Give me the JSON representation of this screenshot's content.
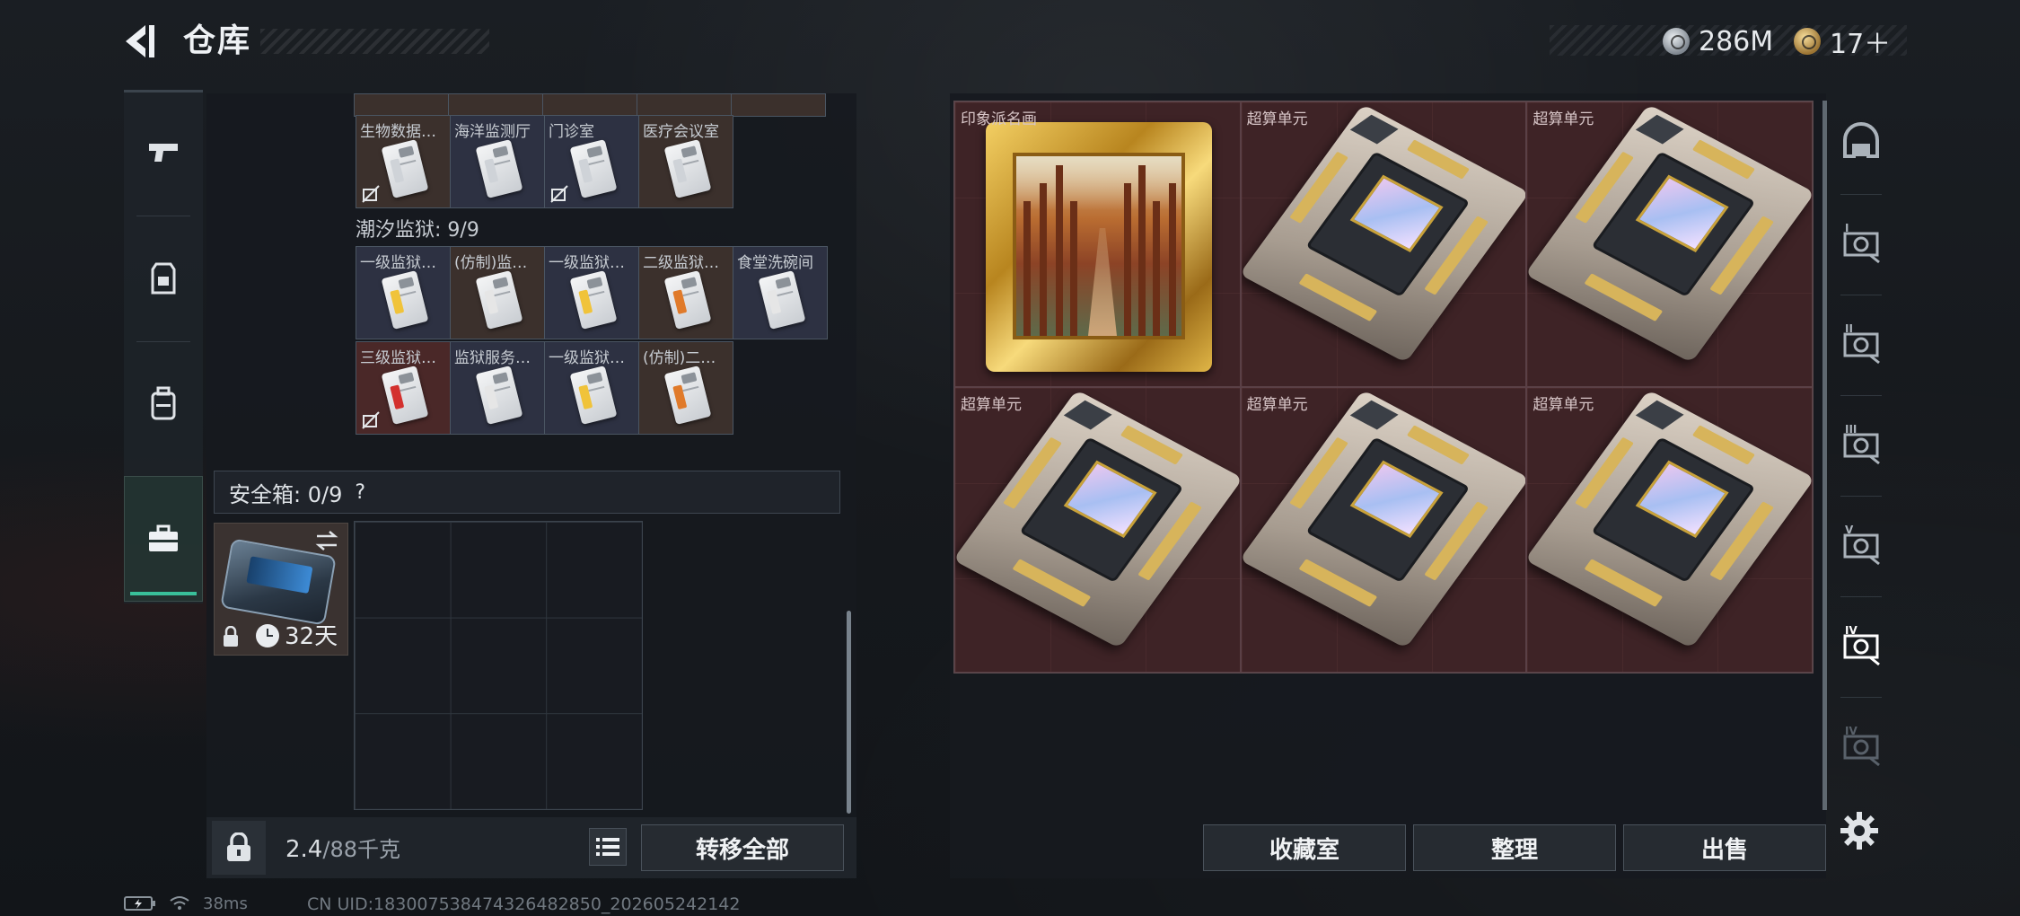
{
  "header": {
    "title": "仓库"
  },
  "currency": [
    {
      "icon": "silver-coin-icon",
      "value": "286M"
    },
    {
      "icon": "gold-coin-icon",
      "value": "17＋"
    }
  ],
  "left_categories": [
    {
      "name": "weapons",
      "icon": "pistol-icon"
    },
    {
      "name": "armor",
      "icon": "vest-icon"
    },
    {
      "name": "backpack",
      "icon": "backpack-icon"
    },
    {
      "name": "cases",
      "icon": "toolbox-icon",
      "active": true
    }
  ],
  "stash": {
    "row_top": [
      {
        "label": "生物数据…",
        "color": "brown",
        "no_link": true
      },
      {
        "label": "海洋监测厅",
        "color": "slate",
        "no_link": false
      },
      {
        "label": "门诊室",
        "color": "slate",
        "no_link": true
      },
      {
        "label": "医疗会议室",
        "color": "brown",
        "no_link": false
      }
    ],
    "section_title": "潮汐监狱: 9/9",
    "row_a": [
      {
        "label": "一级监狱…",
        "color": "slate",
        "stripe": "#f0c33a"
      },
      {
        "label": "(仿制)监…",
        "color": "brown",
        "stripe": "#e6e6e6"
      },
      {
        "label": "一级监狱…",
        "color": "slate",
        "stripe": "#f0c33a"
      },
      {
        "label": "二级监狱…",
        "color": "brown",
        "stripe": "#e07a2a"
      },
      {
        "label": "食堂洗碗间",
        "color": "slate",
        "stripe": "#e6e6e6"
      }
    ],
    "row_b": [
      {
        "label": "三级监狱…",
        "color": "red",
        "stripe": "#d3312e",
        "no_link": true
      },
      {
        "label": "监狱服务…",
        "color": "slate",
        "stripe": "#e6e6e6"
      },
      {
        "label": "一级监狱…",
        "color": "slate",
        "stripe": "#f0c33a"
      },
      {
        "label": "(仿制)二…",
        "color": "brown",
        "stripe": "#e07a2a"
      }
    ],
    "safe_box": {
      "label": "安全箱: 0/9",
      "help": "?",
      "days": "32天"
    },
    "weight": {
      "current": "2.4",
      "max": "/88千克"
    },
    "transfer_all": "转移全部"
  },
  "container": {
    "items": [
      {
        "label": "印象派名画",
        "type": "painting"
      },
      {
        "label": "超算单元",
        "type": "board"
      },
      {
        "label": "超算单元",
        "type": "board"
      },
      {
        "label": "超算单元",
        "type": "board"
      },
      {
        "label": "超算单元",
        "type": "board"
      },
      {
        "label": "超算单元",
        "type": "board"
      }
    ],
    "buttons": {
      "collection": "收藏室",
      "organize": "整理",
      "sell": "出售"
    }
  },
  "right_rail": [
    "helmet-icon",
    "level-1-card-icon",
    "level-2-card-icon",
    "level-3-card-icon",
    "level-5-card-icon",
    "level-4-card-icon",
    "level-4-card-dim-icon"
  ],
  "status": {
    "ping": "38ms",
    "uid": "CN UID:183007538474326482850_202605242142"
  }
}
